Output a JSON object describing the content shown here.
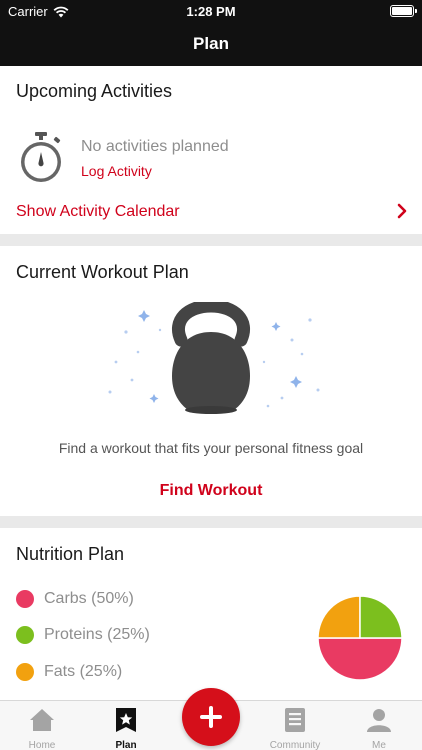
{
  "status_bar": {
    "carrier": "Carrier",
    "time": "1:28 PM"
  },
  "header": {
    "title": "Plan"
  },
  "upcoming": {
    "title": "Upcoming Activities",
    "empty_text": "No activities planned",
    "log_link": "Log Activity",
    "calendar_link": "Show Activity Calendar"
  },
  "workout": {
    "title": "Current Workout Plan",
    "description": "Find a workout that fits your personal fitness goal",
    "find_button": "Find Workout"
  },
  "nutrition": {
    "title": "Nutrition Plan",
    "items": [
      {
        "label": "Carbs (50%)",
        "percent": 50,
        "color": "#e93a62"
      },
      {
        "label": "Proteins (25%)",
        "percent": 25,
        "color": "#7cbf1e"
      },
      {
        "label": "Fats (25%)",
        "percent": 25,
        "color": "#f2a10f"
      }
    ]
  },
  "tabs": [
    {
      "label": "Home",
      "icon": "home-icon",
      "active": false
    },
    {
      "label": "Plan",
      "icon": "plan-star-icon",
      "active": true
    },
    {
      "label": "",
      "icon": "plus-icon",
      "active": false
    },
    {
      "label": "Community",
      "icon": "community-icon",
      "active": false
    },
    {
      "label": "Me",
      "icon": "person-icon",
      "active": false
    }
  ],
  "colors": {
    "accent": "#d0021b",
    "header_bg": "#111111"
  }
}
